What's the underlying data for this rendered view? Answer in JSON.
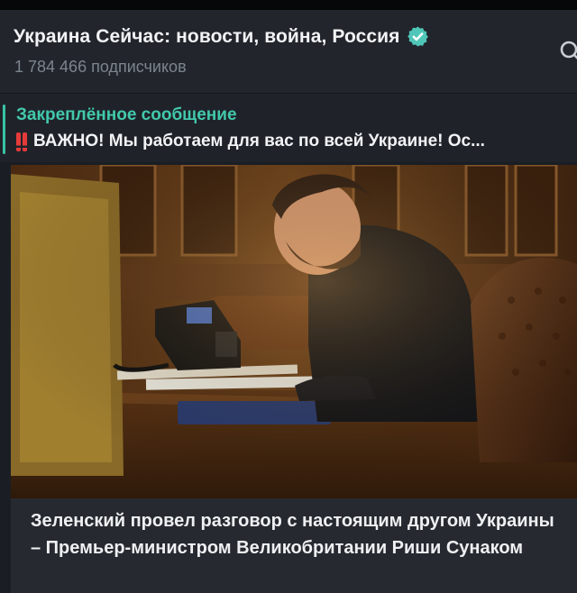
{
  "channel": {
    "title": "Украина Сейчас: новости, война, Россия",
    "verified_icon": "verified-badge-icon",
    "subscribers": "1 784 466 подписчиков",
    "search_icon": "search-icon"
  },
  "pinned": {
    "label": "Закреплённое сообщение",
    "icon": "double-exclamation-icon",
    "text": "ВАЖНО! Мы работаем для вас по всей Украине! Ос..."
  },
  "post": {
    "image_description_icon": "photo",
    "caption": "Зеленский провел разговор с настоящим другом Украины – Премьер-министром Великобритании Риши Сунаком"
  },
  "colors": {
    "accent": "#42c9ac",
    "background": "#1a1e24",
    "header": "#22262c",
    "verified": "#4fc6b8",
    "alert": "#e63a3a"
  }
}
